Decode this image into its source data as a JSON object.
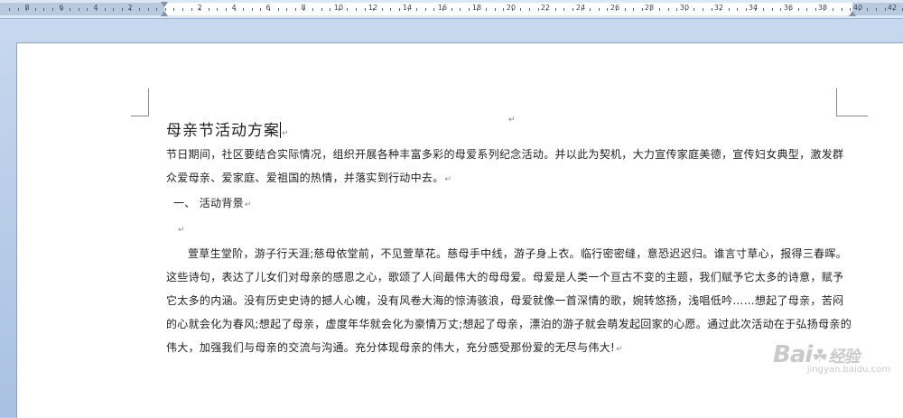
{
  "ruler": {
    "numbers": [
      "8",
      "6",
      "4",
      "2",
      "2",
      "4",
      "6",
      "8",
      "10",
      "12",
      "14",
      "16",
      "18",
      "20",
      "22",
      "24",
      "26",
      "28",
      "30",
      "32",
      "34",
      "36",
      "38",
      "40",
      "42"
    ]
  },
  "document": {
    "top_mark": "↵",
    "title": "母亲节活动方案",
    "title_mark": "↵",
    "para1": "节日期间，社区要结合实际情况，组织开展各种丰富多彩的母爱系列纪念活动。并以此为契机，大力宣传家庭美德，宣传妇女典型，激发群众爱母亲、爱家庭、爱祖国的热情，并落实到行动中去。",
    "para1_mark": "↵",
    "heading1": "一、 活动背景",
    "heading1_mark": "↵",
    "blank_mark": "↵",
    "para2": "萱草生堂阶，游子行天涯;慈母依堂前，不见萱草花。慈母手中线，游子身上衣。临行密密缝，意恐迟迟归。谁言寸草心，报得三春晖。这些诗句，表达了儿女们对母亲的感恩之心，歌颂了人间最伟大的母母爱。母爱是人类一个亘古不变的主题，我们赋予它太多的诗意，赋予它太多的内涵。没有历史史诗的撼人心魄，没有风卷大海的惊涛骇浪，母爱就像一首深情的歌，婉转悠扬，浅唱低吟……想起了母亲，苦闷的心就会化为春风;想起了母亲，虚度年华就会化为豪情万丈;想起了母亲，漂泊的游子就会萌发起回家的心愿。通过此次活动在于弘扬母亲的伟大，加强我们与母亲的交流与沟通。充分体现母亲的伟大，充分感受那份爱的无尽与伟大!",
    "para2_mark": "↵"
  },
  "watermark": {
    "brand": "Bai",
    "paw": "☘",
    "brand2": "经验",
    "sub": "jingyan.baidu.com"
  }
}
